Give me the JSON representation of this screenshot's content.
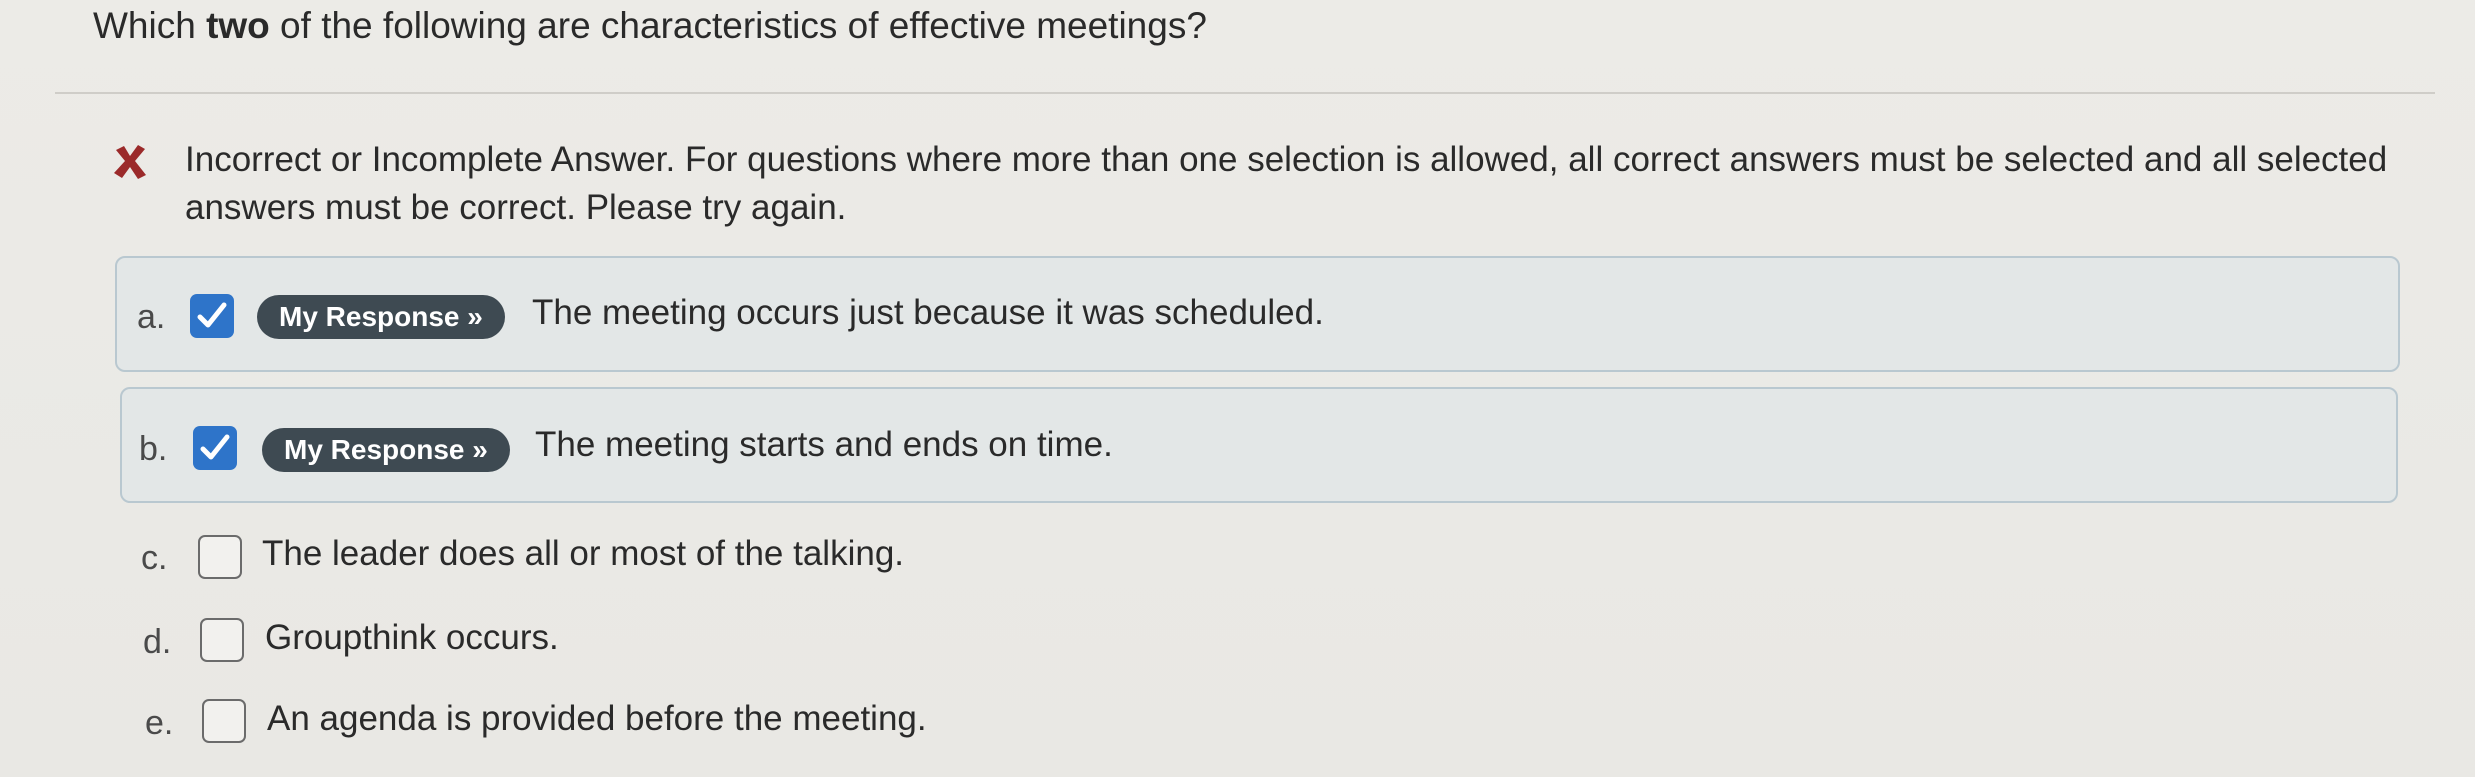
{
  "question": {
    "prefix": "Which ",
    "emphasis": "two",
    "suffix": " of the following are characteristics of effective meetings?"
  },
  "feedback": {
    "icon": "x-mark-icon",
    "icon_color": "#9b2a2a",
    "text": "Incorrect or Incomplete Answer. For questions where more than one selection is allowed, all correct answers must be selected and all selected answers must be correct. Please try again."
  },
  "options": [
    {
      "letter": "a.",
      "checked": true,
      "badge": "My Response »",
      "text": "The meeting occurs just because it was scheduled."
    },
    {
      "letter": "b.",
      "checked": true,
      "badge": "My Response »",
      "text": "The meeting starts and ends on time."
    },
    {
      "letter": "c.",
      "checked": false,
      "text": "The leader does all or most of the talking."
    },
    {
      "letter": "d.",
      "checked": false,
      "text": "Groupthink occurs."
    },
    {
      "letter": "e.",
      "checked": false,
      "text": "An agenda is provided before the meeting."
    }
  ],
  "colors": {
    "checkbox_checked": "#2e74c9",
    "badge_bg": "#3e4a52",
    "card_border": "#b9c8d0"
  }
}
